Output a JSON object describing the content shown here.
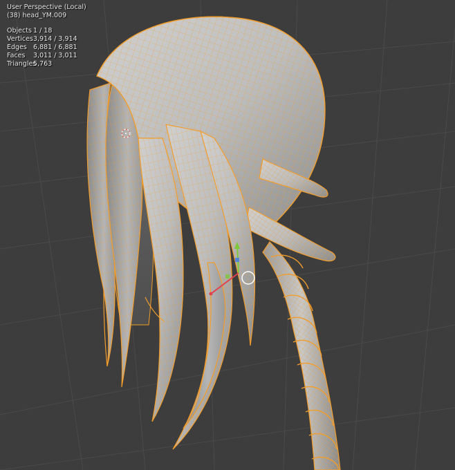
{
  "viewport": {
    "view_name": "User Perspective (Local)",
    "object_name": "(38) head_YM.009"
  },
  "stats": {
    "objects_label": "Objects",
    "objects_value": "1 / 18",
    "vertices_label": "Vertices",
    "vertices_value": "3,914 / 3,914",
    "edges_label": "Edges",
    "edges_value": "6,881 / 6,881",
    "faces_label": "Faces",
    "faces_value": "3,011 / 3,011",
    "triangles_label": "Triangles",
    "triangles_value": "5,763"
  },
  "colors": {
    "background": "#3d3d3d",
    "grid_line": "#4a4a4a",
    "selection_wire": "#f29d2b",
    "mesh_light": "#c4c4c4",
    "mesh_dark": "#5a5a5a"
  }
}
